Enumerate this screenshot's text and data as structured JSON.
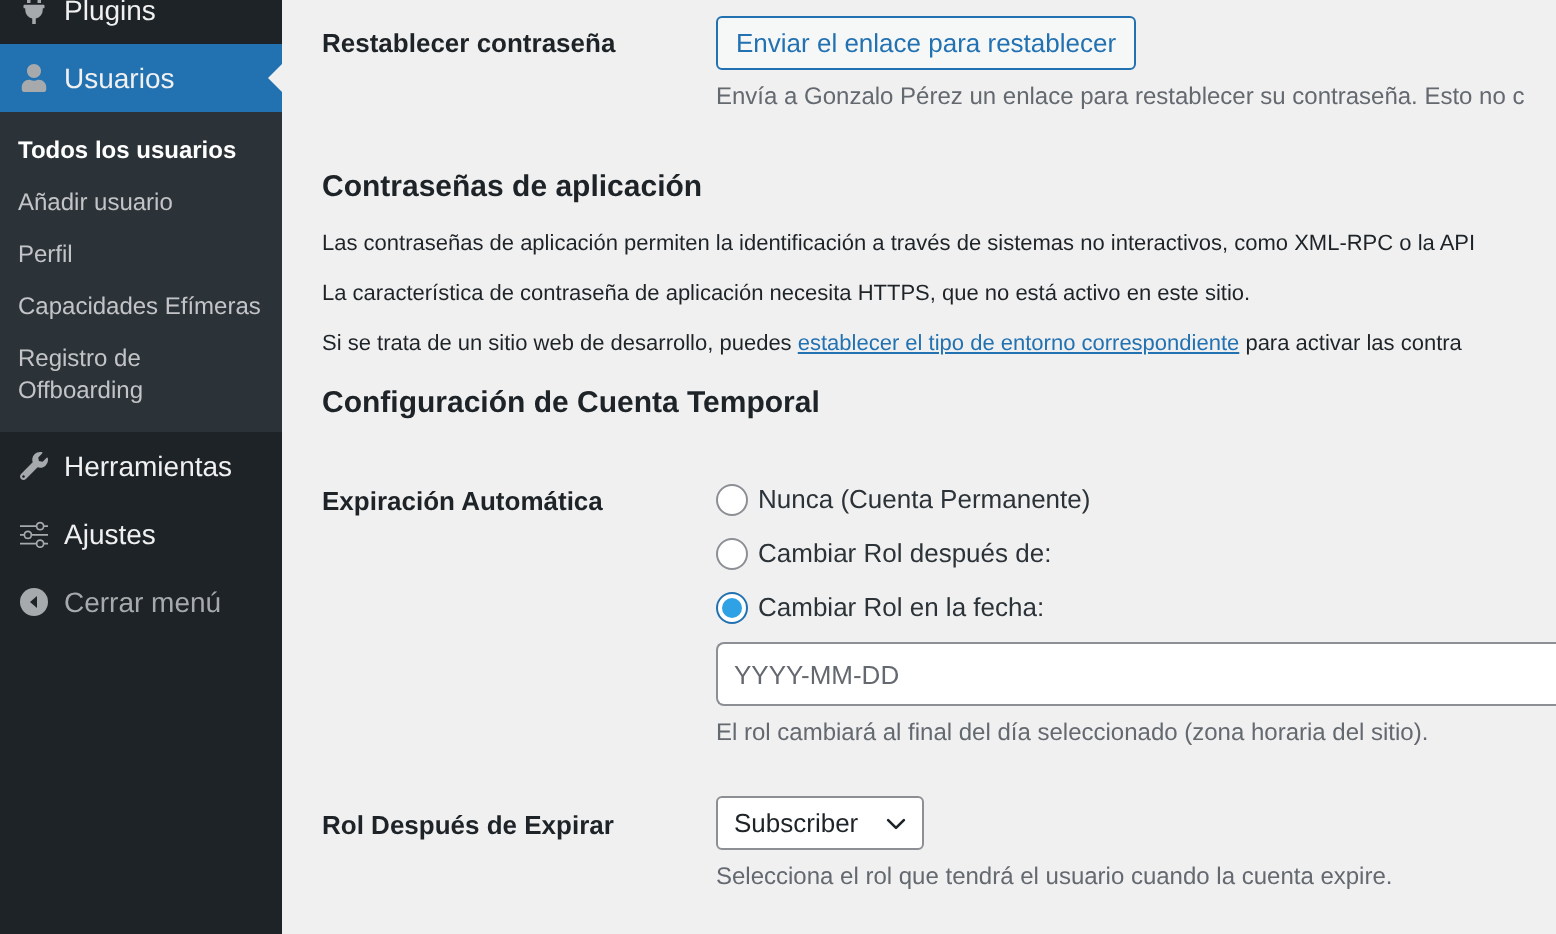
{
  "sidebar": {
    "items": [
      {
        "label": "Plugins",
        "current": false
      },
      {
        "label": "Usuarios",
        "current": true,
        "children": [
          {
            "label": "Todos los usuarios",
            "selected": true
          },
          {
            "label": "Añadir usuario",
            "selected": false
          },
          {
            "label": "Perfil",
            "selected": false
          },
          {
            "label": "Capacidades Efímeras",
            "selected": false
          },
          {
            "label": "Registro de Offboarding",
            "selected": false
          }
        ]
      },
      {
        "label": "Herramientas",
        "current": false
      },
      {
        "label": "Ajustes",
        "current": false
      },
      {
        "label": "Cerrar menú",
        "current": false
      }
    ]
  },
  "reset_password": {
    "label": "Restablecer contraseña",
    "button": "Enviar el enlace para restablecer",
    "description": "Envía a Gonzalo Pérez un enlace para restablecer su contraseña. Esto no c"
  },
  "app_passwords": {
    "title": "Contraseñas de aplicación",
    "paragraphs": [
      {
        "text": "Las contraseñas de aplicación permiten la identificación a través de sistemas no interactivos, como XML-RPC o la API"
      },
      {
        "text": "La característica de contraseña de aplicación necesita HTTPS, que no está activo en este sitio."
      },
      {
        "text": "Si se trata de un sitio web de desarrollo, puedes ",
        "link": "establecer el tipo de entorno correspondiente",
        "after": " para activar las contra"
      }
    ]
  },
  "temp_account": {
    "title": "Configuración de Cuenta Temporal",
    "expiration": {
      "label": "Expiración Automática",
      "options": [
        {
          "label": "Nunca (Cuenta Permanente)",
          "selected": false
        },
        {
          "label": "Cambiar Rol después de:",
          "selected": false
        },
        {
          "label": "Cambiar Rol en la fecha:",
          "selected": true
        }
      ],
      "date_field": {
        "placeholder": "YYYY-MM-DD"
      },
      "description": "El rol cambiará al final del día seleccionado (zona horaria del sitio)."
    },
    "role_after": {
      "label": "Rol Después de Expirar",
      "value": "Subscriber",
      "description": "Selecciona el rol que tendrá el usuario cuando la cuenta expire."
    }
  }
}
